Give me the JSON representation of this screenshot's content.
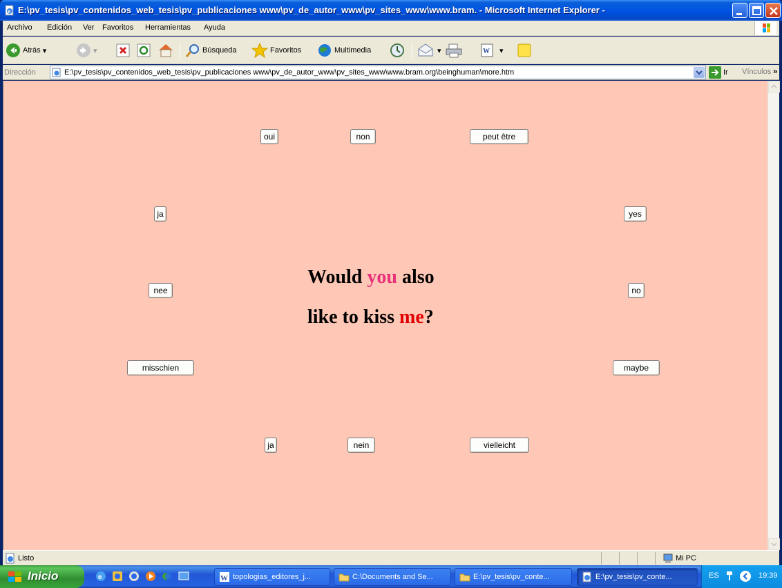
{
  "window": {
    "title": "E:\\pv_tesis\\pv_contenidos_web_tesis\\pv_publicaciones www\\pv_de_autor_www\\pv_sites_www\\www.bram. - Microsoft Internet Explorer -"
  },
  "menu": [
    "Archivo",
    "Edición",
    "Ver",
    "Favoritos",
    "Herramientas",
    "Ayuda"
  ],
  "toolbar": {
    "back": "Atrás",
    "search": "Búsqueda",
    "favorites": "Favoritos",
    "media": "Multimedia"
  },
  "address": {
    "label": "Dirección",
    "url": "E:\\pv_tesis\\pv_contenidos_web_tesis\\pv_publicaciones www\\pv_de_autor_www\\pv_sites_www\\www.bram.org\\beinghuman\\more.htm",
    "go": "Ir",
    "links": "Vínculos"
  },
  "page": {
    "buttons": {
      "oui": "oui",
      "non": "non",
      "peut_etre": "peut être",
      "ja_top": "ja",
      "yes": "yes",
      "nee": "nee",
      "no": "no",
      "misschien": "misschien",
      "maybe": "maybe",
      "ja_bottom": "ja",
      "nein": "nein",
      "vielleicht": "vielleicht"
    },
    "question": {
      "part1": "Would ",
      "you": "you",
      "part2": " also",
      "part3": "like to kiss ",
      "me": "me",
      "part4": "?"
    }
  },
  "status": {
    "text": "Listo",
    "zone": "Mi PC"
  },
  "taskbar": {
    "start": "Inicio",
    "tasks": [
      "topologias_editores_j...",
      "C:\\Documents and Se...",
      "E:\\pv_tesis\\pv_conte...",
      "E:\\pv_tesis\\pv_conte..."
    ],
    "lang": "ES",
    "time": "19:39"
  }
}
